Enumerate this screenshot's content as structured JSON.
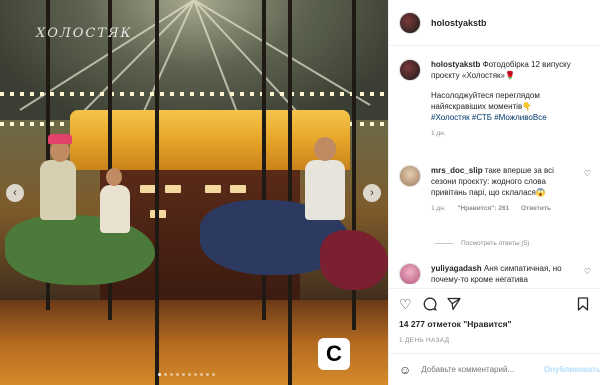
{
  "photo": {
    "watermark": "ХОЛОСТЯК",
    "logo_letter": "C",
    "carousel_dots": 10,
    "active_dot": 0,
    "prev_icon": "chevron-left-icon",
    "next_icon": "chevron-right-icon"
  },
  "header": {
    "username": "holostyakstb"
  },
  "caption": {
    "username": "holostyakstb",
    "line1": "Фотодобірка 12 випуску проєкту «Холостяк»🌹",
    "line2": "Насолоджуйтеся переглядом найяскравіших моментів👇",
    "hashtags": "#Холостяк #СТБ #МожливоВсе",
    "time": "1 дн."
  },
  "comments": [
    {
      "username": "mrs_doc_slip",
      "text": "таке вперше за всі сезони проєкту: жодного слова привітань парі, що склалася😱",
      "time": "1 дн.",
      "likes": "\"Нравится\": 261",
      "reply": "Ответить",
      "view_replies": "Посмотреть ответы (5)"
    },
    {
      "username": "yuliyagadash",
      "text": "Аня симпатичная, но почему-то кроме негатива",
      "time": "",
      "likes": "",
      "reply": ""
    }
  ],
  "actions": {
    "like_icon": "heart-icon",
    "comment_icon": "comment-icon",
    "share_icon": "share-icon",
    "save_icon": "bookmark-icon"
  },
  "likes_text": "14 277 отметок \"Нравится\"",
  "date_text": "1 ДЕНЬ НАЗАД",
  "add_comment": {
    "placeholder": "Добавьте комментарий...",
    "publish": "Опубликовать"
  },
  "colors": {
    "link": "#00376b",
    "muted": "#8e8e8e",
    "publish_disabled": "#b2dffc"
  }
}
